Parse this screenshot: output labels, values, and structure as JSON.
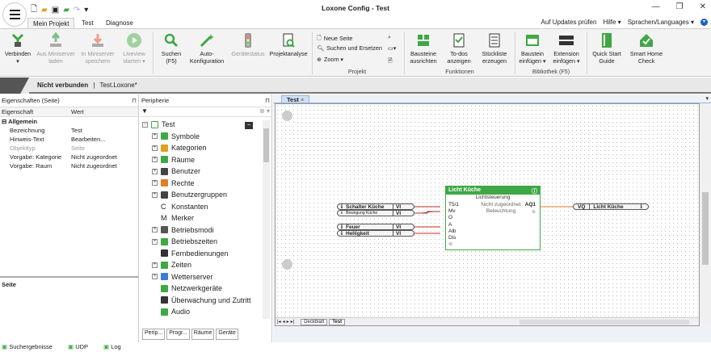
{
  "app": {
    "title": "Loxone Config - Test",
    "window_controls": [
      "—",
      "❐",
      "✕"
    ]
  },
  "tabs": [
    {
      "label": "Mein Projekt",
      "active": true
    },
    {
      "label": "Test"
    },
    {
      "label": "Diagnose"
    }
  ],
  "topright": {
    "updates": "Auf Updates prüfen",
    "help": "Hilfe ▾",
    "language": "Sprachen/Languages ▾"
  },
  "ribbon": {
    "buttons": [
      {
        "label": "Verbinden ▾",
        "icon": "connect-icon",
        "enabled": true
      },
      {
        "label": "Aus Miniserver laden",
        "icon": "download-icon",
        "enabled": false
      },
      {
        "label": "In Miniserver speichern",
        "icon": "upload-icon",
        "enabled": false
      },
      {
        "label": "Liveview starten ▾",
        "icon": "play-icon",
        "enabled": false
      },
      {
        "label": "Suchen (F5)",
        "icon": "search-icon",
        "enabled": true
      },
      {
        "label": "Auto-Konfiguration",
        "icon": "magic-wand-icon",
        "enabled": true
      },
      {
        "label": "Gerätestatus",
        "icon": "traffic-light-icon",
        "enabled": false
      },
      {
        "label": "Projektanalyse",
        "icon": "analysis-icon",
        "enabled": true
      }
    ],
    "project": {
      "new_page": "Neue Seite",
      "search_replace": "Suchen und Ersetzen",
      "zoom": "Zoom ▾",
      "group": "Projekt"
    },
    "functions": {
      "align": "Bausteine ausrichten",
      "todos": "To-dos anzeigen",
      "bom": "Stückliste erzeugen",
      "group": "Funktionen"
    },
    "library": {
      "insert_block": "Baustein einfügen ▾",
      "insert_ext": "Extension einfügen ▾",
      "group": "Bibliothek (F5)"
    },
    "quickstart": "Quick Start Guide",
    "smarthome": "Smart Home Check"
  },
  "status": {
    "connection": "Nicht verbunden",
    "separator": "|",
    "file": "Test.Loxone*"
  },
  "properties": {
    "header": "Eigenschaften (Seite)",
    "col_prop": "Eigenschaft",
    "col_val": "Wert",
    "section": "Allgemein",
    "rows": [
      {
        "k": "Bezeichnung",
        "v": "Test"
      },
      {
        "k": "Hinweis-Text",
        "v": "Bearbeiten..."
      },
      {
        "k": "Objekttyp",
        "v": "Seite",
        "grey": true
      },
      {
        "k": "Vorgabe: Kategorie",
        "v": "Nicht zugeordnet"
      },
      {
        "k": "Vorgabe: Raum",
        "v": "Nicht zugeordnet"
      }
    ]
  },
  "seite": {
    "label": "Seite"
  },
  "periphery": {
    "header": "Peripherie",
    "root": "Test",
    "items": [
      {
        "label": "Symbole",
        "color": "#3fa845"
      },
      {
        "label": "Kategorien",
        "color": "#e0a020"
      },
      {
        "label": "Räume",
        "color": "#3fa845"
      },
      {
        "label": "Benutzer",
        "color": "#444"
      },
      {
        "label": "Rechte",
        "color": "#e08020"
      },
      {
        "label": "Benutzergruppen",
        "color": "#444"
      },
      {
        "label": "Konstanten",
        "glyph": "C",
        "noexp": true
      },
      {
        "label": "Merker",
        "glyph": "M",
        "noexp": true
      },
      {
        "label": "Betriebsmodi",
        "color": "#555"
      },
      {
        "label": "Betriebszeiten",
        "color": "#3fa845"
      },
      {
        "label": "Fernbedienungen",
        "color": "#333",
        "noexp": true
      },
      {
        "label": "Zeiten",
        "color": "#3fa845"
      },
      {
        "label": "Wetterserver",
        "color": "#3a7bd5"
      },
      {
        "label": "Netzwerkgeräte",
        "color": "#3fa845",
        "noexp": true
      },
      {
        "label": "Überwachung und Zutritt",
        "color": "#333",
        "noexp": true
      },
      {
        "label": "Audio",
        "color": "#3fa845",
        "noexp": true
      }
    ],
    "bottom_tabs": [
      "Perip...",
      "Progr...",
      "Räume",
      "Geräte"
    ]
  },
  "canvas": {
    "tab": "Test",
    "sheets": [
      "Deckblatt",
      "Test"
    ]
  },
  "block": {
    "title": "Licht Küche",
    "subtitle": "Lichtsteuerung",
    "room": "Nicht zugeordnet",
    "cat": "Beleuchtung",
    "inputs": [
      "T5/1",
      "Mv",
      "O",
      "A",
      "Alb",
      "Dis"
    ],
    "output": "AQ1"
  },
  "inputs_left": [
    {
      "name": "Schalter Küche",
      "type": "VI"
    },
    {
      "name": "Bewegung Küche",
      "type": "VI"
    },
    {
      "name": "Feuer",
      "type": "VI"
    },
    {
      "name": "Helligkeit",
      "type": "VI"
    }
  ],
  "output_right": {
    "type": "VQ",
    "name": "Licht Küche"
  },
  "footer": [
    "Suchergebnisse",
    "UDP",
    "Log"
  ],
  "colors": {
    "accent": "#3fa845",
    "ribbon": "#f3f3f3"
  }
}
